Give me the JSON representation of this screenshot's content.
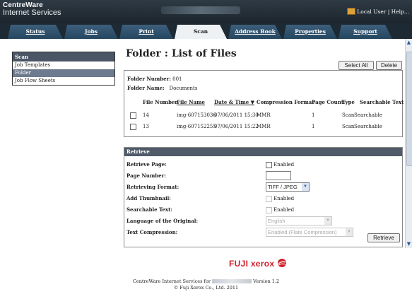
{
  "header": {
    "logo_line1": "CentreWare",
    "logo_line2": "Internet Services",
    "user_link": "Local User | Help..."
  },
  "tabs": [
    {
      "label": "Status"
    },
    {
      "label": "Jobs"
    },
    {
      "label": "Print"
    },
    {
      "label": "Scan"
    },
    {
      "label": "Address Book"
    },
    {
      "label": "Properties"
    },
    {
      "label": "Support"
    }
  ],
  "sidebar": {
    "title": "Scan",
    "items": [
      {
        "label": "Job Templates"
      },
      {
        "label": "Folder"
      },
      {
        "label": "Job Flow Sheets"
      }
    ]
  },
  "page": {
    "title": "Folder : List of Files",
    "select_all": "Select All",
    "delete": "Delete"
  },
  "folder": {
    "number_label": "Folder Number:",
    "number": "001",
    "name_label": "Folder Name:",
    "name": "Documents"
  },
  "table": {
    "headers": [
      "File Number",
      "File Name",
      "Date & Time ▼",
      "Compression Format",
      "Page Count",
      "Type",
      "Searchable Text"
    ],
    "rows": [
      {
        "number": "14",
        "name": "img-607153036",
        "datetime": "07/06/2011 15:30",
        "format": "MMR",
        "pages": "1",
        "type": "Scan",
        "searchable": "Searchable"
      },
      {
        "number": "13",
        "name": "img-607152255",
        "datetime": "07/06/2011 15:22",
        "format": "MMR",
        "pages": "1",
        "type": "Scan",
        "searchable": "Searchable"
      }
    ]
  },
  "retrieve": {
    "title": "Retrieve",
    "page_label": "Retrieve Page:",
    "page_enabled": "Enabled",
    "page_number_label": "Page Number:",
    "page_number_value": "",
    "format_label": "Retrieving Format:",
    "format_value": "TIFF / JPEG",
    "thumbnail_label": "Add Thumbnail:",
    "thumbnail_enabled": "Enabled",
    "searchable_label": "Searchable Text:",
    "searchable_enabled": "Enabled",
    "language_label": "Language of the Original:",
    "language_value": "English",
    "compression_label": "Text Compression:",
    "compression_value": "Enabled (Flate Compression)",
    "button": "Retrieve"
  },
  "footer": {
    "brand": "FUJI xerox",
    "line1_pre": "CentreWare Internet Services for",
    "line1_post": "Version 1.2",
    "line2": "© Fuji Xerox Co., Ltd. 2011"
  }
}
